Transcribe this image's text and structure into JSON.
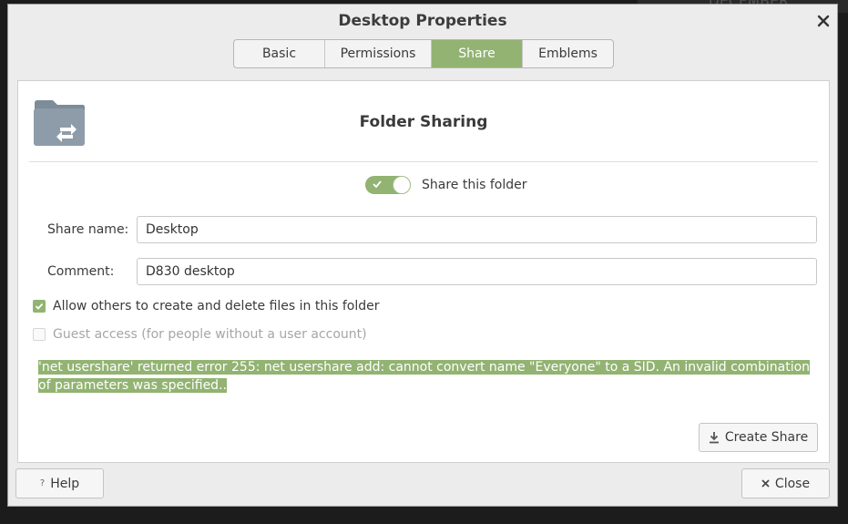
{
  "background": {
    "text": "DECEMBER"
  },
  "window": {
    "title": "Desktop Properties"
  },
  "tabs": [
    {
      "label": "Basic",
      "active": false
    },
    {
      "label": "Permissions",
      "active": false
    },
    {
      "label": "Share",
      "active": true
    },
    {
      "label": "Emblems",
      "active": false
    }
  ],
  "share": {
    "heading": "Folder Sharing",
    "toggle": {
      "label": "Share this folder",
      "on": true
    },
    "share_name": {
      "label": "Share name:",
      "value": "Desktop"
    },
    "comment": {
      "label": "Comment:",
      "value": "D830 desktop"
    },
    "allow_others": {
      "label": "Allow others to create and delete files in this folder",
      "checked": true
    },
    "guest_access": {
      "label": "Guest access (for people without a user account)",
      "checked": false,
      "enabled": false
    },
    "error": "'net usershare' returned error 255: net usershare add: cannot convert name \"Everyone\" to a SID. An invalid combination of parameters was specified..",
    "create_button": "Create Share"
  },
  "footer": {
    "help_label": "Help",
    "close_label": "Close"
  },
  "colors": {
    "accent": "#92b372",
    "folder": "#8a9aa6"
  },
  "icons": {
    "close": "close-icon",
    "folder": "folder-share-icon",
    "download": "download-icon",
    "help": "help-icon",
    "check": "check-icon"
  }
}
